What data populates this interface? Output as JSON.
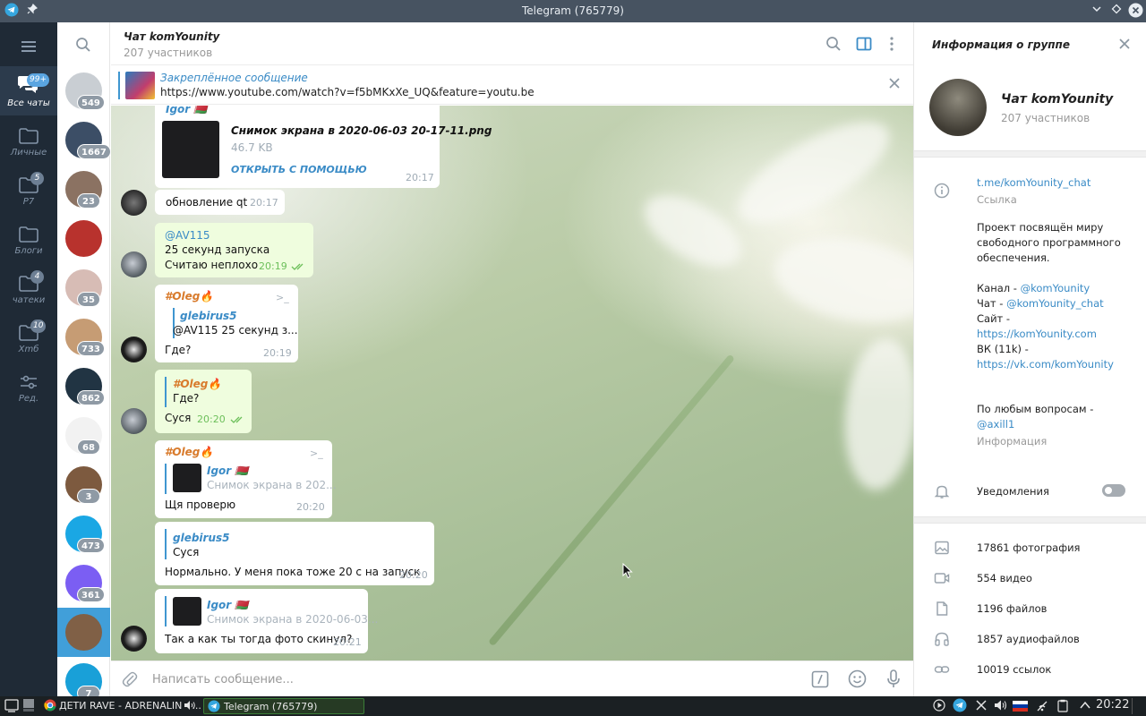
{
  "window": {
    "title": "Telegram (765779)"
  },
  "rail": {
    "menu_icon": "hamburger-icon",
    "folders": [
      {
        "label": "Все чаты",
        "badge": "99+",
        "icon": "chats-icon",
        "active": true
      },
      {
        "label": "Личные",
        "badge": "",
        "icon": "folder-icon"
      },
      {
        "label": "P7",
        "badge": "5",
        "icon": "folder-icon"
      },
      {
        "label": "Блоги",
        "badge": "",
        "icon": "folder-icon"
      },
      {
        "label": "чатеки",
        "badge": "4",
        "icon": "folder-icon"
      },
      {
        "label": "Xmб",
        "badge": "10",
        "icon": "folder-icon"
      },
      {
        "label": "Ред.",
        "badge": "",
        "icon": "edit-folders-icon"
      }
    ]
  },
  "chatlist": {
    "items": [
      {
        "badge": "549",
        "color": "#c9ced3"
      },
      {
        "badge": "1667",
        "color": "#3c4e66"
      },
      {
        "badge": "23",
        "color": "#8b7262"
      },
      {
        "badge": "",
        "color": "#b8322d"
      },
      {
        "badge": "35",
        "color": "#d7bcb5"
      },
      {
        "badge": "733",
        "color": "#c69c74"
      },
      {
        "badge": "862",
        "color": "#213443"
      },
      {
        "badge": "68",
        "color": "#f2f2f2"
      },
      {
        "badge": "3",
        "color": "#7d5a3f"
      },
      {
        "badge": "473",
        "color": "#1aa7e4"
      },
      {
        "badge": "361",
        "color": "#7b5ef3"
      },
      {
        "badge": "",
        "color": "#806046"
      },
      {
        "badge": "7",
        "color": "#19a0d8"
      }
    ]
  },
  "chat": {
    "name": "Чат komYounity",
    "members": "207 участников",
    "pinned": {
      "title": "Закреплённое сообщение",
      "text": "https://www.youtube.com/watch?v=f5bMKxXe_UQ&feature=youtu.be"
    },
    "messages": [
      {
        "sender": "Igor 🇧🇾",
        "file_name": "Снимок экрана в 2020-06-03 20-17-11.png",
        "file_size": "46.7 KB",
        "file_action": "ОТКРЫТЬ С ПОМОЩЬЮ",
        "time": "20:17"
      },
      {
        "text": "обновление qt",
        "time": "20:17"
      },
      {
        "mention": "@AV115",
        "line1": " 25 секунд запуска",
        "line2": "Считаю неплохо",
        "time": "20:19"
      },
      {
        "sender": "#Oleg🔥",
        "reply_name": "glebirus5",
        "reply_text": "@AV115  25 секунд з...",
        "text": "Где?",
        "time": "20:19"
      },
      {
        "reply_name": "#Oleg🔥",
        "reply_text": "Где?",
        "text": "Суся",
        "time": "20:20"
      },
      {
        "sender": "#Oleg🔥",
        "reply_name": "Igor 🇧🇾",
        "reply_text": "Снимок экрана в 202...",
        "text": "Щя проверю",
        "time": "20:20"
      },
      {
        "reply_name": "glebirus5",
        "reply_text": "Суся",
        "text": "Нормально. У меня пока тоже 20 с на запуск",
        "time": "20:20"
      },
      {
        "reply_name": "Igor 🇧🇾",
        "reply_text": "Снимок экрана в 2020-06-03...",
        "text": "Так а как ты тогда фото скинул?",
        "time": "20:21"
      }
    ],
    "composer_placeholder": "Написать сообщение..."
  },
  "info": {
    "title": "Информация о группе",
    "group_name": "Чат komYounity",
    "group_members": "207 участников",
    "link": "t.me/komYounity_chat",
    "link_caption": "Ссылка",
    "desc1": "Проект посвящён миру",
    "desc2": "свободного программного",
    "desc3": "обеспечения.",
    "channel_label": "Канал - ",
    "channel": "@komYounity",
    "chat_label": "Чат - ",
    "chat": "@komYounity_chat",
    "site_label": "Сайт -",
    "site": "https://komYounity.com",
    "vk_label": "ВК (11k) -",
    "vk": "https://vk.com/komYounity",
    "questions": "По любым вопросам -",
    "contact": "@axill1",
    "about_caption": "Информация",
    "notifications": "Уведомления",
    "notifications_on": false,
    "media": [
      {
        "label": "17861 фотография",
        "icon": "photo-icon"
      },
      {
        "label": "554 видео",
        "icon": "video-icon"
      },
      {
        "label": "1196 файлов",
        "icon": "file-icon"
      },
      {
        "label": "1857 аудиофайлов",
        "icon": "headphones-icon"
      },
      {
        "label": "10019 ссылок",
        "icon": "link-icon"
      }
    ]
  },
  "taskbar": {
    "task1": "ДЕТИ RAVE - ADRENALIN - ...",
    "task2": "Telegram (765779)",
    "clock": "20:22"
  }
}
